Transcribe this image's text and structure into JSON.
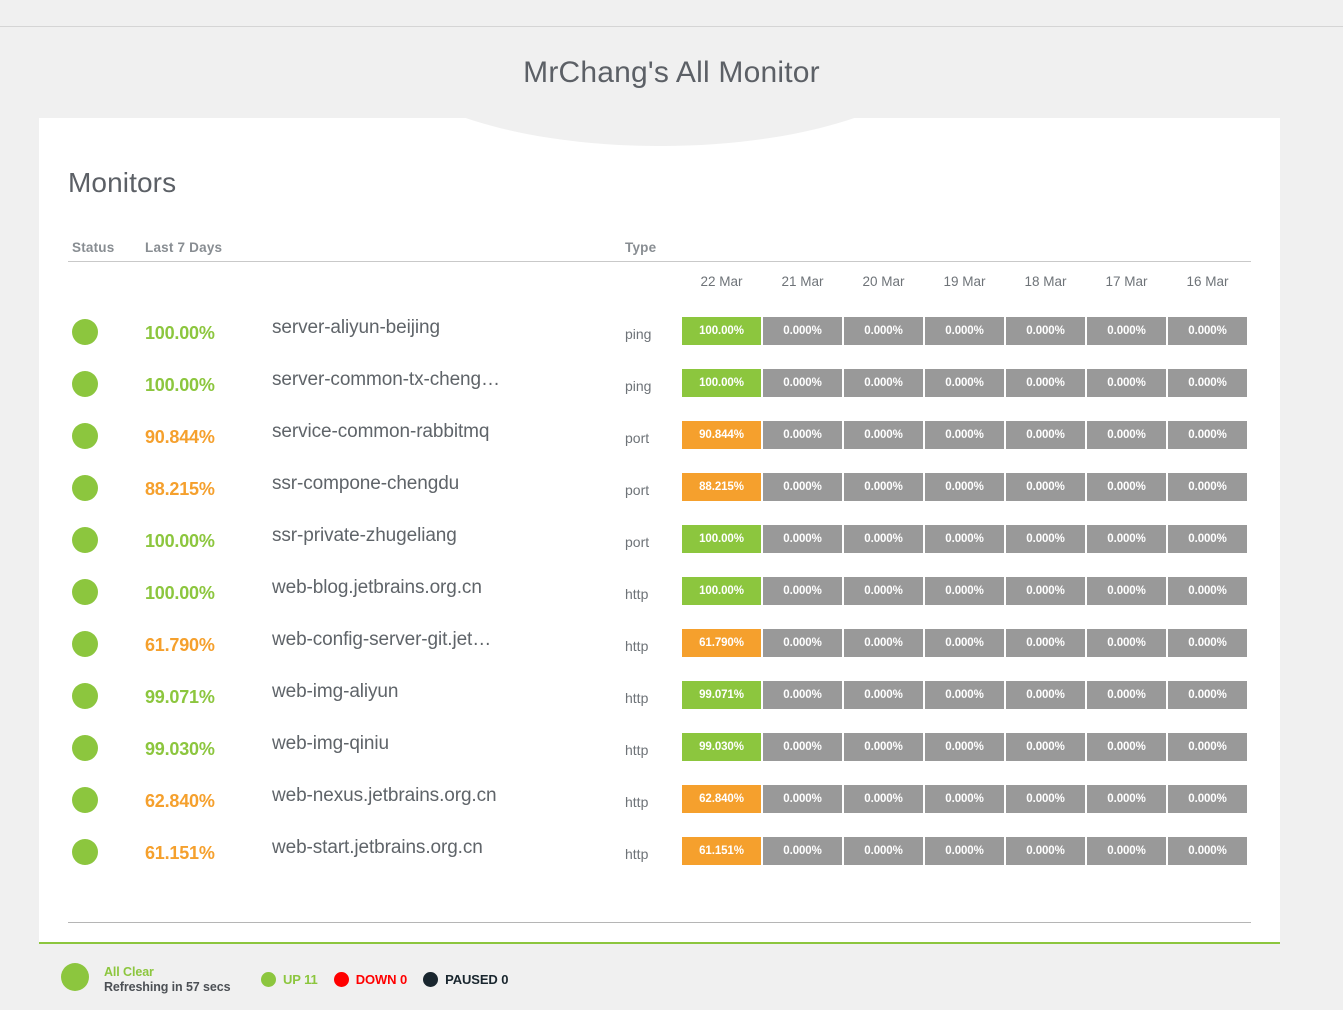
{
  "page": {
    "title": "MrChang's All Monitor",
    "background": "#f0f0f0"
  },
  "card": {
    "section_title": "Monitors"
  },
  "table": {
    "headers": {
      "status": "Status",
      "uptime": "Last 7 Days",
      "type": "Type"
    },
    "dates": [
      "22 Mar",
      "21 Mar",
      "20 Mar",
      "19 Mar",
      "18 Mar",
      "17 Mar",
      "16 Mar"
    ],
    "rows": [
      {
        "status": "up",
        "uptime": "100.00%",
        "uptime_state": "good",
        "name": "server-aliyun-beijing",
        "type": "ping",
        "bars": [
          {
            "value": "100.00%",
            "state": "up"
          },
          {
            "value": "0.000%",
            "state": "empty"
          },
          {
            "value": "0.000%",
            "state": "empty"
          },
          {
            "value": "0.000%",
            "state": "empty"
          },
          {
            "value": "0.000%",
            "state": "empty"
          },
          {
            "value": "0.000%",
            "state": "empty"
          },
          {
            "value": "0.000%",
            "state": "empty"
          }
        ]
      },
      {
        "status": "up",
        "uptime": "100.00%",
        "uptime_state": "good",
        "name": "server-common-tx-cheng…",
        "type": "ping",
        "bars": [
          {
            "value": "100.00%",
            "state": "up"
          },
          {
            "value": "0.000%",
            "state": "empty"
          },
          {
            "value": "0.000%",
            "state": "empty"
          },
          {
            "value": "0.000%",
            "state": "empty"
          },
          {
            "value": "0.000%",
            "state": "empty"
          },
          {
            "value": "0.000%",
            "state": "empty"
          },
          {
            "value": "0.000%",
            "state": "empty"
          }
        ]
      },
      {
        "status": "up",
        "uptime": "90.844%",
        "uptime_state": "warn",
        "name": "service-common-rabbitmq",
        "type": "port",
        "bars": [
          {
            "value": "90.844%",
            "state": "warn"
          },
          {
            "value": "0.000%",
            "state": "empty"
          },
          {
            "value": "0.000%",
            "state": "empty"
          },
          {
            "value": "0.000%",
            "state": "empty"
          },
          {
            "value": "0.000%",
            "state": "empty"
          },
          {
            "value": "0.000%",
            "state": "empty"
          },
          {
            "value": "0.000%",
            "state": "empty"
          }
        ]
      },
      {
        "status": "up",
        "uptime": "88.215%",
        "uptime_state": "warn",
        "name": "ssr-compone-chengdu",
        "type": "port",
        "bars": [
          {
            "value": "88.215%",
            "state": "warn"
          },
          {
            "value": "0.000%",
            "state": "empty"
          },
          {
            "value": "0.000%",
            "state": "empty"
          },
          {
            "value": "0.000%",
            "state": "empty"
          },
          {
            "value": "0.000%",
            "state": "empty"
          },
          {
            "value": "0.000%",
            "state": "empty"
          },
          {
            "value": "0.000%",
            "state": "empty"
          }
        ]
      },
      {
        "status": "up",
        "uptime": "100.00%",
        "uptime_state": "good",
        "name": "ssr-private-zhugeliang",
        "type": "port",
        "bars": [
          {
            "value": "100.00%",
            "state": "up"
          },
          {
            "value": "0.000%",
            "state": "empty"
          },
          {
            "value": "0.000%",
            "state": "empty"
          },
          {
            "value": "0.000%",
            "state": "empty"
          },
          {
            "value": "0.000%",
            "state": "empty"
          },
          {
            "value": "0.000%",
            "state": "empty"
          },
          {
            "value": "0.000%",
            "state": "empty"
          }
        ]
      },
      {
        "status": "up",
        "uptime": "100.00%",
        "uptime_state": "good",
        "name": "web-blog.jetbrains.org.cn",
        "type": "http",
        "bars": [
          {
            "value": "100.00%",
            "state": "up"
          },
          {
            "value": "0.000%",
            "state": "empty"
          },
          {
            "value": "0.000%",
            "state": "empty"
          },
          {
            "value": "0.000%",
            "state": "empty"
          },
          {
            "value": "0.000%",
            "state": "empty"
          },
          {
            "value": "0.000%",
            "state": "empty"
          },
          {
            "value": "0.000%",
            "state": "empty"
          }
        ]
      },
      {
        "status": "up",
        "uptime": "61.790%",
        "uptime_state": "warn",
        "name": "web-config-server-git.jet…",
        "type": "http",
        "bars": [
          {
            "value": "61.790%",
            "state": "warn"
          },
          {
            "value": "0.000%",
            "state": "empty"
          },
          {
            "value": "0.000%",
            "state": "empty"
          },
          {
            "value": "0.000%",
            "state": "empty"
          },
          {
            "value": "0.000%",
            "state": "empty"
          },
          {
            "value": "0.000%",
            "state": "empty"
          },
          {
            "value": "0.000%",
            "state": "empty"
          }
        ]
      },
      {
        "status": "up",
        "uptime": "99.071%",
        "uptime_state": "good",
        "name": "web-img-aliyun",
        "type": "http",
        "bars": [
          {
            "value": "99.071%",
            "state": "up"
          },
          {
            "value": "0.000%",
            "state": "empty"
          },
          {
            "value": "0.000%",
            "state": "empty"
          },
          {
            "value": "0.000%",
            "state": "empty"
          },
          {
            "value": "0.000%",
            "state": "empty"
          },
          {
            "value": "0.000%",
            "state": "empty"
          },
          {
            "value": "0.000%",
            "state": "empty"
          }
        ]
      },
      {
        "status": "up",
        "uptime": "99.030%",
        "uptime_state": "good",
        "name": "web-img-qiniu",
        "type": "http",
        "bars": [
          {
            "value": "99.030%",
            "state": "up"
          },
          {
            "value": "0.000%",
            "state": "empty"
          },
          {
            "value": "0.000%",
            "state": "empty"
          },
          {
            "value": "0.000%",
            "state": "empty"
          },
          {
            "value": "0.000%",
            "state": "empty"
          },
          {
            "value": "0.000%",
            "state": "empty"
          },
          {
            "value": "0.000%",
            "state": "empty"
          }
        ]
      },
      {
        "status": "up",
        "uptime": "62.840%",
        "uptime_state": "warn",
        "name": "web-nexus.jetbrains.org.cn",
        "type": "http",
        "bars": [
          {
            "value": "62.840%",
            "state": "warn"
          },
          {
            "value": "0.000%",
            "state": "empty"
          },
          {
            "value": "0.000%",
            "state": "empty"
          },
          {
            "value": "0.000%",
            "state": "empty"
          },
          {
            "value": "0.000%",
            "state": "empty"
          },
          {
            "value": "0.000%",
            "state": "empty"
          },
          {
            "value": "0.000%",
            "state": "empty"
          }
        ]
      },
      {
        "status": "up",
        "uptime": "61.151%",
        "uptime_state": "warn",
        "name": "web-start.jetbrains.org.cn",
        "type": "http",
        "bars": [
          {
            "value": "61.151%",
            "state": "warn"
          },
          {
            "value": "0.000%",
            "state": "empty"
          },
          {
            "value": "0.000%",
            "state": "empty"
          },
          {
            "value": "0.000%",
            "state": "empty"
          },
          {
            "value": "0.000%",
            "state": "empty"
          },
          {
            "value": "0.000%",
            "state": "empty"
          },
          {
            "value": "0.000%",
            "state": "empty"
          }
        ]
      }
    ]
  },
  "footer": {
    "overall_status": "All Clear",
    "refresh_text": "Refreshing in 57 secs",
    "legend": [
      {
        "label": "UP 11",
        "color": "#8cc63e"
      },
      {
        "label": "DOWN 0",
        "color": "#ff0000"
      },
      {
        "label": "PAUSED 0",
        "color": "#19262e"
      }
    ]
  },
  "colors": {
    "up": "#8cc63e",
    "warn": "#f5a02d",
    "empty": "#999999",
    "down": "#ff0000",
    "paused": "#19262e",
    "text": "#5c6066"
  }
}
